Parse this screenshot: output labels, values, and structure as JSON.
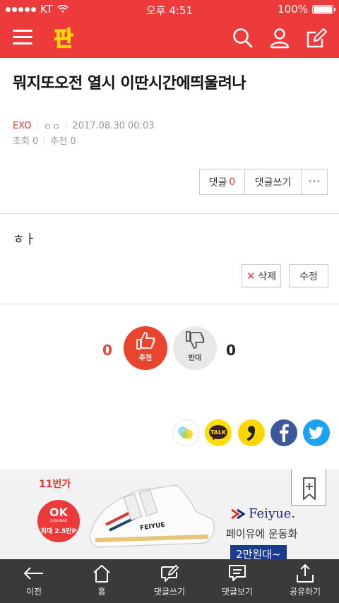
{
  "status": {
    "carrier": "KT",
    "time": "오후 4:51",
    "battery": "100%"
  },
  "header": {
    "logo_text": "판"
  },
  "post": {
    "title": "뭐지또오전 열시 이딴시간에띄울려나",
    "category": "EXO",
    "author": "ㅇㅇ",
    "datetime": "2017.08.30 00:03",
    "views": "조회 0",
    "recommends": "추천 0",
    "body": "ㅎㅏ"
  },
  "actions": {
    "comment_label": "댓글",
    "comment_count": "0",
    "write_comment": "댓글쓰기",
    "more": "•••",
    "delete": "삭제",
    "delete_mark": "✕",
    "edit": "수정"
  },
  "vote": {
    "up_count": "0",
    "up_label": "추천",
    "down_label": "반대",
    "down_count": "0"
  },
  "share": [
    "kakaostory-icon",
    "kakaotalk-icon",
    "comma-icon",
    "facebook-icon",
    "twitter-icon"
  ],
  "share_talk_label": "TALK",
  "ad": {
    "brand": "11번가",
    "ok_title": "OK",
    "ok_sub": "CASHBAG",
    "ok_amount": "최대 2.5만P",
    "feiyue": "Feiyue.",
    "tagline": "페이유에 운동화",
    "price": "2만원대~",
    "shoe_text": "FEIYUE"
  },
  "bottom_nav": [
    {
      "label": "이전",
      "icon": "back-arrow-icon"
    },
    {
      "label": "홈",
      "icon": "home-icon"
    },
    {
      "label": "댓글쓰기",
      "icon": "write-comment-icon"
    },
    {
      "label": "댓글보기",
      "icon": "view-comments-icon"
    },
    {
      "label": "공유하기",
      "icon": "share-icon"
    }
  ],
  "colors": {
    "brand_red": "#ed3b3b",
    "nav_bg": "#3a3a3a",
    "vote_up": "#e9442e",
    "vote_down": "#e8e8e8"
  }
}
